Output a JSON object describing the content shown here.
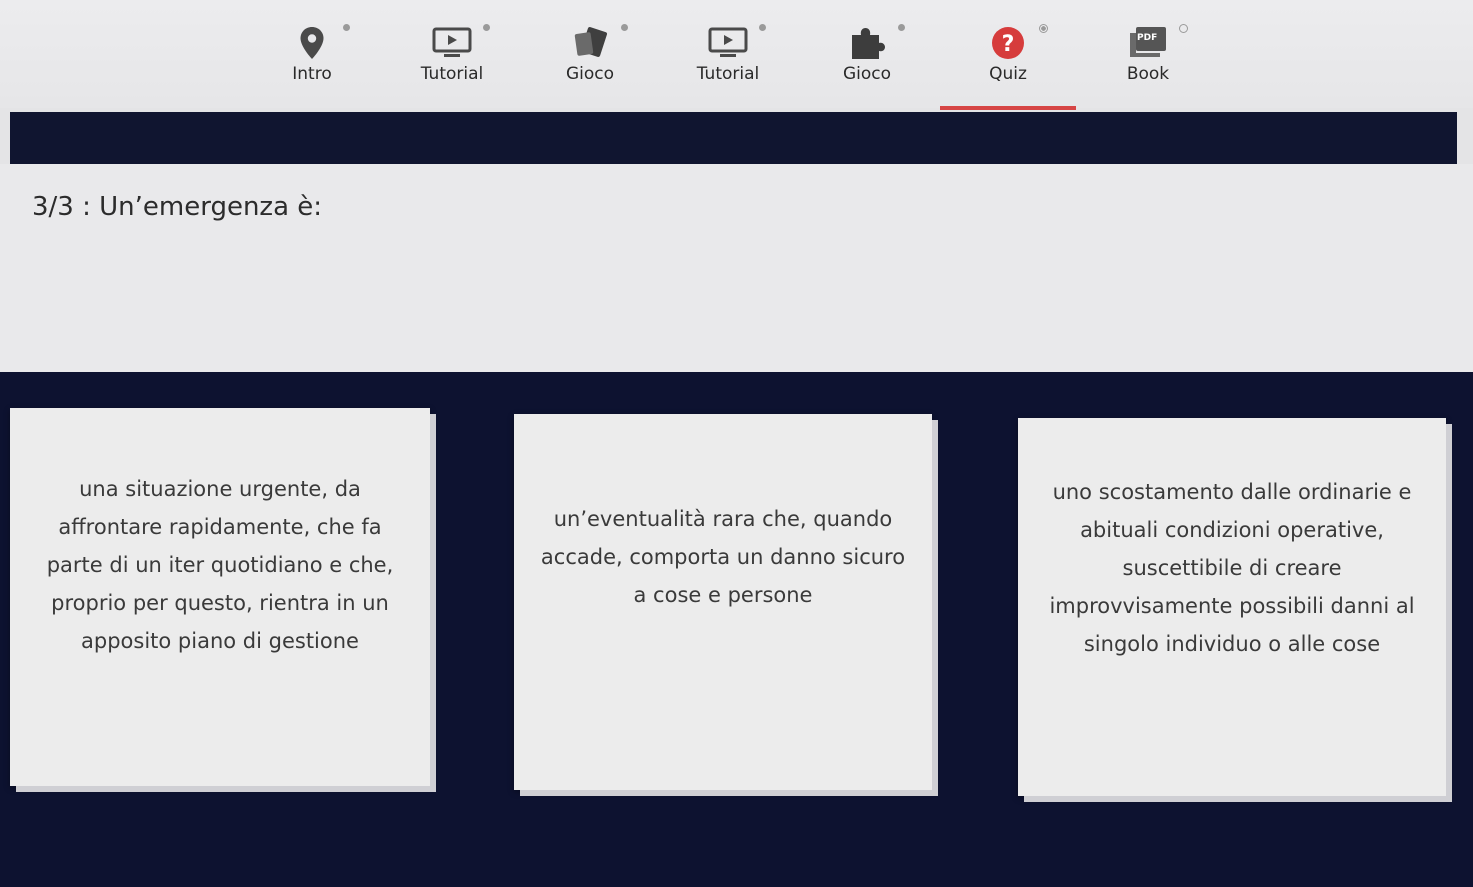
{
  "nav": {
    "items": [
      {
        "label": "Intro",
        "icon": "map-pin-icon",
        "status": "done"
      },
      {
        "label": "Tutorial",
        "icon": "video-icon",
        "status": "done"
      },
      {
        "label": "Gioco",
        "icon": "cards-icon",
        "status": "done"
      },
      {
        "label": "Tutorial",
        "icon": "video-icon",
        "status": "done"
      },
      {
        "label": "Gioco",
        "icon": "puzzle-icon",
        "status": "done"
      },
      {
        "label": "Quiz",
        "icon": "question-icon",
        "status": "current"
      },
      {
        "label": "Book",
        "icon": "pdf-icon",
        "status": "todo"
      }
    ],
    "active_label": "Quiz",
    "pdf_badge": "PDF"
  },
  "question": {
    "text": "3/3 : Un’emergenza è:"
  },
  "answers": [
    "una situazione urgente, da affrontare rapidamente, che fa parte di un iter quotidiano e che, proprio per questo, rientra in un apposito piano di gestione",
    "un’eventualità rara che, quando accade, comporta un danno sicuro a cose e persone",
    "uno scostamento dalle ordinarie e abituali condizioni operative, suscettibile di creare improvvisamente possibili danni al singolo individuo o alle cose"
  ],
  "colors": {
    "dark_navy": "#0d1230",
    "active_underline": "#d64545",
    "question_icon": "#d63c3c"
  }
}
